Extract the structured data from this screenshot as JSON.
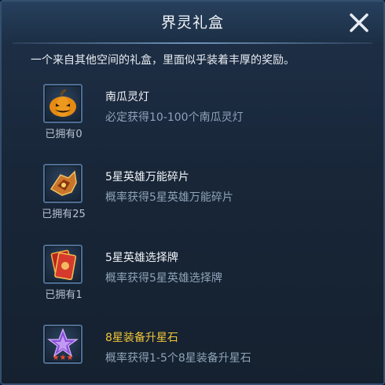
{
  "dialog": {
    "title": "界灵礼盒",
    "description": "一个来自其他空间的礼盒，里面似乎装着丰厚的奖励。"
  },
  "items": [
    {
      "name": "南瓜灵灯",
      "info": "必定获得10-100个南瓜灵灯",
      "owned": "已拥有0",
      "icon": "pumpkin-lantern-icon"
    },
    {
      "name": "5星英雄万能碎片",
      "info": "概率获得5星英雄万能碎片",
      "owned": "已拥有25",
      "icon": "hero-fragment-icon"
    },
    {
      "name": "5星英雄选择牌",
      "info": "概率获得5星英雄选择牌",
      "owned": "已拥有1",
      "icon": "hero-card-icon"
    },
    {
      "name": "8星装备升星石",
      "info": "概率获得1-5个8星装备升星石",
      "owned": "",
      "icon": "star-stone-icon",
      "stars": "★★★",
      "name_color": "#f2c738"
    }
  ]
}
